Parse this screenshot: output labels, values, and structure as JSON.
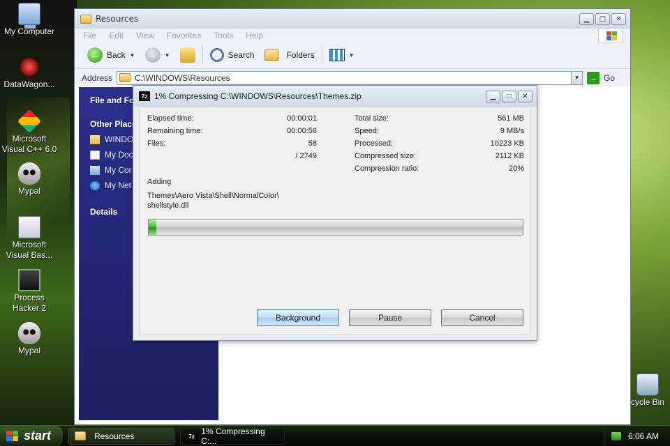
{
  "desktop": {
    "icons": [
      {
        "label": "My Computer",
        "icon": "computer-icon"
      },
      {
        "label": "DataWagon...",
        "icon": "datawagon-icon"
      },
      {
        "label": "Microsoft Visual C++ 6.0",
        "icon": "visual-cpp-icon"
      },
      {
        "label": "Mypal",
        "icon": "mypal-icon"
      },
      {
        "label": "Microsoft Visual Bas...",
        "icon": "visual-basic-icon"
      },
      {
        "label": "Process Hacker 2",
        "icon": "process-hacker-icon"
      },
      {
        "label": "Mypal",
        "icon": "mypal-icon"
      },
      {
        "label": "cycle Bin",
        "icon": "recycle-bin-icon"
      }
    ]
  },
  "explorer": {
    "title": "Resources",
    "menu": [
      "File",
      "Edit",
      "View",
      "Favorites",
      "Tools",
      "Help"
    ],
    "toolbar": {
      "back": "Back",
      "search": "Search",
      "folders": "Folders"
    },
    "address": {
      "label": "Address",
      "value": "C:\\WINDOWS\\Resources",
      "go": "Go"
    },
    "taskpane": {
      "file_folder": "File and Fol",
      "other_places": "Other Place",
      "links": [
        "WINDO",
        "My Doc",
        "My Cor",
        "My Net"
      ],
      "details": "Details"
    }
  },
  "dialog": {
    "title": "1% Compressing C:\\WINDOWS\\Resources\\Themes.zip",
    "app_icon": "7z",
    "left_stats": [
      {
        "label": "Elapsed time:",
        "value": "00:00:01"
      },
      {
        "label": "Remaining time:",
        "value": "00:00:56"
      },
      {
        "label": "Files:",
        "value": "58"
      },
      {
        "label": "",
        "value": "/ 2749"
      }
    ],
    "right_stats": [
      {
        "label": "Total size:",
        "value": "561 MB"
      },
      {
        "label": "Speed:",
        "value": "9 MB/s"
      },
      {
        "label": "Processed:",
        "value": "10223 KB"
      },
      {
        "label": "Compressed size:",
        "value": "2112 KB"
      },
      {
        "label": "Compression ratio:",
        "value": "20%"
      }
    ],
    "action": "Adding",
    "path_line1": "Themes\\Aero Vista\\Shell\\NormalColor\\",
    "path_line2": "shellstyle.dll",
    "progress_fraction": 0.01,
    "buttons": {
      "background": "Background",
      "pause": "Pause",
      "cancel": "Cancel"
    }
  },
  "taskbar": {
    "start": "start",
    "tasks": [
      {
        "label": "Resources",
        "active": false
      },
      {
        "label": "1% Compressing C:...",
        "active": true
      }
    ],
    "clock": "6:06 AM"
  }
}
